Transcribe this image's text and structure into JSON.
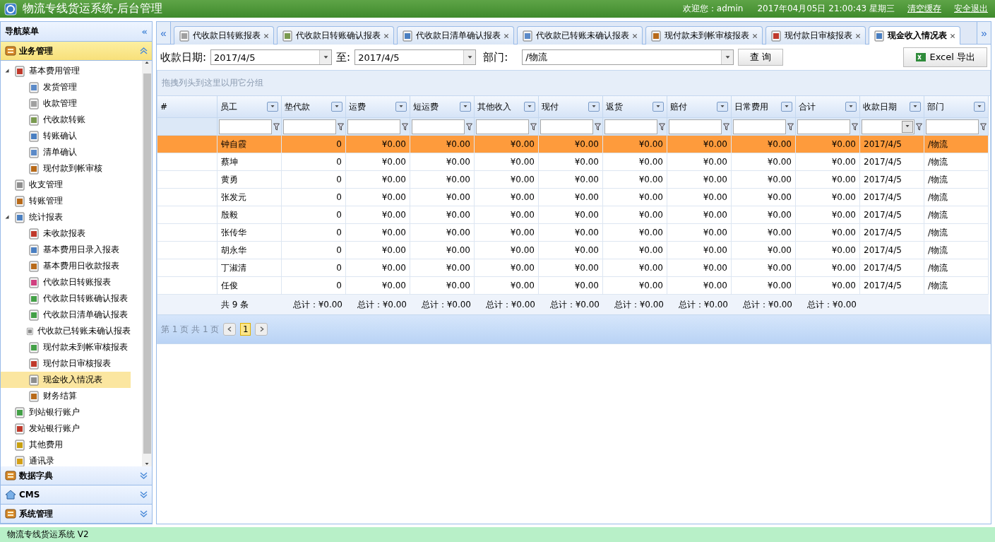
{
  "header": {
    "title": "物流专线货运系统-后台管理",
    "welcome": "欢迎您：admin",
    "datetime": "2017年04月05日 21:00:43 星期三",
    "links": [
      "清空缓存",
      "安全退出"
    ]
  },
  "sidebar": {
    "title": "导航菜单",
    "collapse": "«",
    "sections": [
      {
        "label": "业务管理",
        "expanded": true,
        "items": [
          {
            "label": "基本费用管理",
            "expanded": true,
            "selected": false,
            "children": [
              {
                "label": "发货管理",
                "selected": false
              },
              {
                "label": "收款管理",
                "selected": false
              },
              {
                "label": "代收款转账",
                "selected": false
              },
              {
                "label": "转账确认",
                "selected": false
              },
              {
                "label": "清单确认",
                "selected": false
              },
              {
                "label": "现付款到帐审核",
                "selected": false
              }
            ]
          },
          {
            "label": "收支管理",
            "selected": false
          },
          {
            "label": "转账管理",
            "selected": false
          },
          {
            "label": "统计报表",
            "expanded": true,
            "selected": false,
            "children": [
              {
                "label": "未收款报表",
                "selected": false
              },
              {
                "label": "基本费用日录入报表",
                "selected": false
              },
              {
                "label": "基本费用日收款报表",
                "selected": false
              },
              {
                "label": "代收款日转账报表",
                "selected": false
              },
              {
                "label": "代收款日转账确认报表",
                "selected": false
              },
              {
                "label": "代收款日清单确认报表",
                "selected": false
              },
              {
                "label": "代收款已转账未确认报表",
                "selected": false
              },
              {
                "label": "现付款未到帐审核报表",
                "selected": false
              },
              {
                "label": "现付款日审核报表",
                "selected": false
              },
              {
                "label": "现金收入情况表",
                "selected": true
              },
              {
                "label": "财务结算",
                "selected": false
              }
            ]
          },
          {
            "label": "到站银行账户",
            "selected": false
          },
          {
            "label": "发站银行账户",
            "selected": false
          },
          {
            "label": "其他费用",
            "selected": false
          },
          {
            "label": "通讯录",
            "selected": false
          }
        ]
      },
      {
        "label": "数据字典",
        "expanded": false
      },
      {
        "label": "CMS",
        "expanded": false
      },
      {
        "label": "系统管理",
        "expanded": false
      }
    ]
  },
  "tabs": [
    {
      "label": "代收款日转账报表",
      "selected": false
    },
    {
      "label": "代收款日转账确认报表",
      "selected": false
    },
    {
      "label": "代收款日清单确认报表",
      "selected": false
    },
    {
      "label": "代收款已转账未确认报表",
      "selected": false
    },
    {
      "label": "现付款未到帐审核报表",
      "selected": false
    },
    {
      "label": "现付款日审核报表",
      "selected": false
    },
    {
      "label": "现金收入情况表",
      "selected": true
    }
  ],
  "tab_scroll": {
    "left": "«",
    "right": "»"
  },
  "filters": {
    "date_label": "收款日期:",
    "date_from": "2017/4/5",
    "to_label": "至:",
    "date_to": "2017/4/5",
    "dept_label": "部门:",
    "dept": "/物流",
    "query": "查 询",
    "export": "Excel 导出"
  },
  "group_hint": "拖拽列头到这里以用它分组",
  "table": {
    "columns": [
      "#",
      "员工",
      "垫代款",
      "运费",
      "短运费",
      "其他收入",
      "现付",
      "返货",
      "赔付",
      "日常费用",
      "合计",
      "收款日期",
      "部门"
    ],
    "rows": [
      {
        "selected": true,
        "cells": [
          "",
          "钟自霞",
          "0",
          "¥0.00",
          "¥0.00",
          "¥0.00",
          "¥0.00",
          "¥0.00",
          "¥0.00",
          "¥0.00",
          "¥0.00",
          "2017/4/5",
          "/物流"
        ]
      },
      {
        "selected": false,
        "cells": [
          "",
          "蔡坤",
          "0",
          "¥0.00",
          "¥0.00",
          "¥0.00",
          "¥0.00",
          "¥0.00",
          "¥0.00",
          "¥0.00",
          "¥0.00",
          "2017/4/5",
          "/物流"
        ]
      },
      {
        "selected": false,
        "cells": [
          "",
          "黄勇",
          "0",
          "¥0.00",
          "¥0.00",
          "¥0.00",
          "¥0.00",
          "¥0.00",
          "¥0.00",
          "¥0.00",
          "¥0.00",
          "2017/4/5",
          "/物流"
        ]
      },
      {
        "selected": false,
        "cells": [
          "",
          "张发元",
          "0",
          "¥0.00",
          "¥0.00",
          "¥0.00",
          "¥0.00",
          "¥0.00",
          "¥0.00",
          "¥0.00",
          "¥0.00",
          "2017/4/5",
          "/物流"
        ]
      },
      {
        "selected": false,
        "cells": [
          "",
          "殷毅",
          "0",
          "¥0.00",
          "¥0.00",
          "¥0.00",
          "¥0.00",
          "¥0.00",
          "¥0.00",
          "¥0.00",
          "¥0.00",
          "2017/4/5",
          "/物流"
        ]
      },
      {
        "selected": false,
        "cells": [
          "",
          "张传华",
          "0",
          "¥0.00",
          "¥0.00",
          "¥0.00",
          "¥0.00",
          "¥0.00",
          "¥0.00",
          "¥0.00",
          "¥0.00",
          "2017/4/5",
          "/物流"
        ]
      },
      {
        "selected": false,
        "cells": [
          "",
          "胡永华",
          "0",
          "¥0.00",
          "¥0.00",
          "¥0.00",
          "¥0.00",
          "¥0.00",
          "¥0.00",
          "¥0.00",
          "¥0.00",
          "2017/4/5",
          "/物流"
        ]
      },
      {
        "selected": false,
        "cells": [
          "",
          "丁淑清",
          "0",
          "¥0.00",
          "¥0.00",
          "¥0.00",
          "¥0.00",
          "¥0.00",
          "¥0.00",
          "¥0.00",
          "¥0.00",
          "2017/4/5",
          "/物流"
        ]
      },
      {
        "selected": false,
        "cells": [
          "",
          "任俊",
          "0",
          "¥0.00",
          "¥0.00",
          "¥0.00",
          "¥0.00",
          "¥0.00",
          "¥0.00",
          "¥0.00",
          "¥0.00",
          "2017/4/5",
          "/物流"
        ]
      }
    ],
    "summary": [
      "共 9 条",
      "总计：¥0.00",
      "总计：¥0.00",
      "总计：¥0.00",
      "总计：¥0.00",
      "总计：¥0.00",
      "总计：¥0.00",
      "总计：¥0.00",
      "总计：¥0.00",
      "总计：¥0.00"
    ]
  },
  "pager": {
    "info": "第 1 页 共 1 页",
    "pages": [
      {
        "label": "1",
        "selected": true
      }
    ]
  },
  "status_bar": "物流专线货运系统 V2"
}
